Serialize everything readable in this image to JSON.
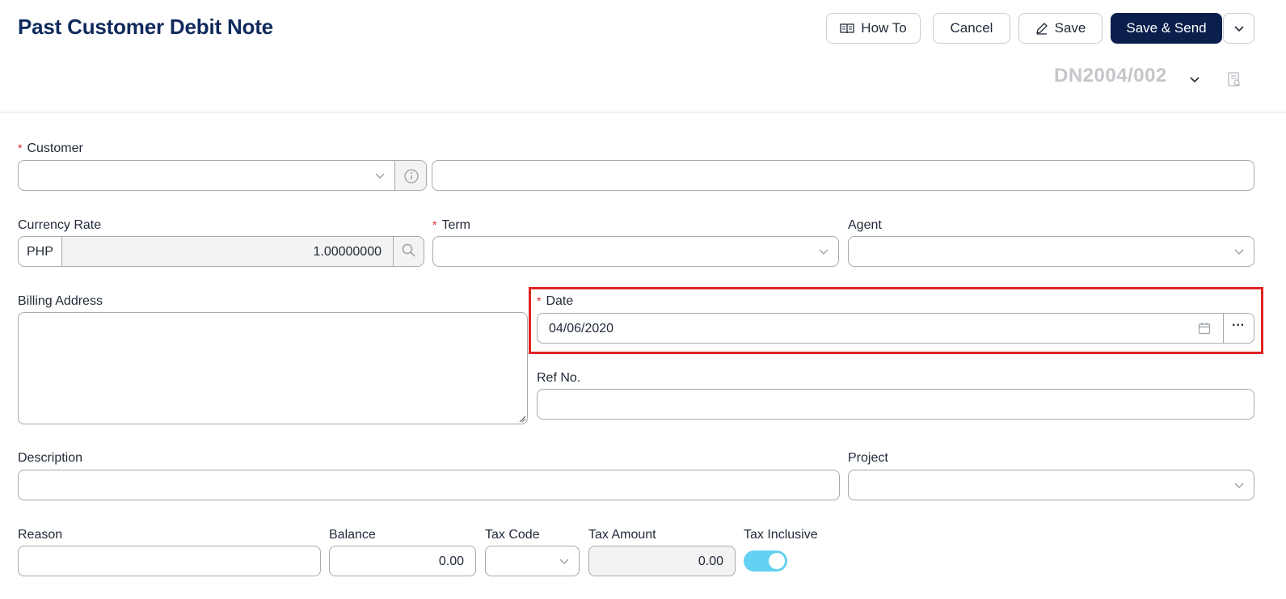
{
  "header": {
    "title": "Past Customer Debit Note",
    "how_to": "How To",
    "cancel": "Cancel",
    "save": "Save",
    "save_send": "Save & Send",
    "doc_number": "DN2004/002"
  },
  "form": {
    "customer": {
      "label": "Customer",
      "required": "*",
      "value": "",
      "name_value": ""
    },
    "currency_rate": {
      "label": "Currency Rate",
      "currency": "PHP",
      "rate": "1.00000000"
    },
    "term": {
      "label": "Term",
      "required": "*",
      "value": ""
    },
    "agent": {
      "label": "Agent",
      "value": ""
    },
    "billing_address": {
      "label": "Billing Address",
      "value": ""
    },
    "date": {
      "label": "Date",
      "required": "*",
      "value": "04/06/2020",
      "more": "···"
    },
    "ref_no": {
      "label": "Ref No.",
      "value": ""
    },
    "description": {
      "label": "Description",
      "value": ""
    },
    "project": {
      "label": "Project",
      "value": ""
    },
    "reason": {
      "label": "Reason",
      "value": ""
    },
    "balance": {
      "label": "Balance",
      "value": "0.00"
    },
    "tax_code": {
      "label": "Tax Code",
      "value": ""
    },
    "tax_amount": {
      "label": "Tax Amount",
      "value": "0.00"
    },
    "tax_inclusive": {
      "label": "Tax Inclusive",
      "on": true
    }
  },
  "colors": {
    "brand": "#0f2a5c",
    "primary_button": "#0b1f4d",
    "toggle_on": "#63d1f2",
    "required": "#e02424",
    "highlight": "#e02424"
  }
}
